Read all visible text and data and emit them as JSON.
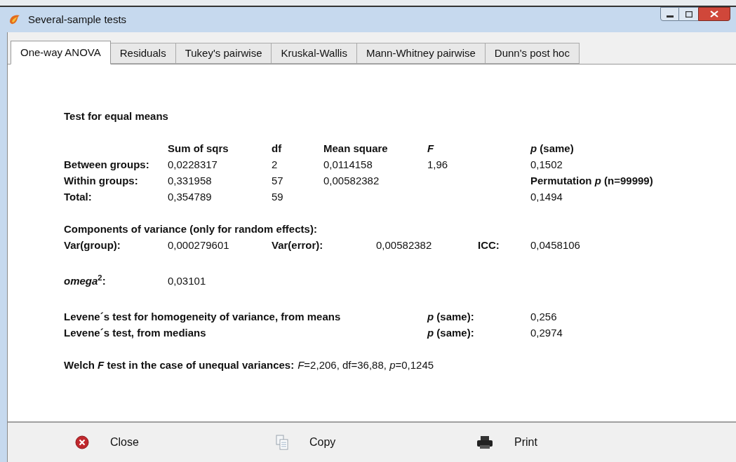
{
  "window": {
    "title": "Several-sample tests"
  },
  "tabs": [
    {
      "label": "One-way ANOVA",
      "selected": true
    },
    {
      "label": "Residuals",
      "selected": false
    },
    {
      "label": "Tukey's pairwise",
      "selected": false
    },
    {
      "label": "Kruskal-Wallis",
      "selected": false
    },
    {
      "label": "Mann-Whitney pairwise",
      "selected": false
    },
    {
      "label": "Dunn's post hoc",
      "selected": false
    }
  ],
  "anova": {
    "heading": "Test for equal means",
    "columns": [
      "Sum of sqrs",
      "df",
      "Mean square",
      "*F*",
      "*p* (same)"
    ],
    "rows": [
      {
        "label": "Between groups:",
        "cells": [
          {
            "text": "0,0228317",
            "kind": "value"
          },
          {
            "text": "2",
            "kind": "value"
          },
          {
            "text": "0,0114158",
            "kind": "value"
          },
          {
            "text": "1,96",
            "kind": "value"
          },
          {
            "text": "0,1502",
            "kind": "value"
          }
        ]
      },
      {
        "label": "Within groups:",
        "cells": [
          {
            "text": "0,331958",
            "kind": "value"
          },
          {
            "text": "57",
            "kind": "value"
          },
          {
            "text": "0,00582382",
            "kind": "value"
          },
          {
            "text": ""
          },
          {
            "text": "Permutation *p* (n=99999)",
            "kind": "heading"
          }
        ]
      },
      {
        "label": "Total:",
        "cells": [
          {
            "text": "0,354789",
            "kind": "value"
          },
          {
            "text": "59",
            "kind": "value"
          },
          {
            "text": ""
          },
          {
            "text": ""
          },
          {
            "text": "0,1494",
            "kind": "value"
          }
        ]
      }
    ]
  },
  "variance": {
    "heading": "Components of variance (only for random effects):",
    "items": [
      {
        "label": "Var(group):",
        "value": "0,000279601"
      },
      {
        "label": "Var(error):",
        "value": "0,00582382"
      },
      {
        "label": "ICC:",
        "value": "0,0458106"
      }
    ]
  },
  "omega": {
    "label": "*omega*$^{2}$:",
    "value": "0,03101"
  },
  "levene": [
    {
      "label": "Levene´s test for homogeneity of variance, from means",
      "p_label": "*p* (same):",
      "value": "0,256"
    },
    {
      "label": "Levene´s test, from medians",
      "p_label": "*p* (same):",
      "value": "0,2974"
    }
  ],
  "welch": {
    "label": "Welch *F* test in the case of unequal variances:",
    "result": "*F*=2,206, df=36,88, *p*=0,1245"
  },
  "buttons": [
    {
      "label": "Close",
      "kind": "close"
    },
    {
      "label": "Copy",
      "kind": "copy"
    },
    {
      "label": "Print",
      "kind": "print"
    }
  ]
}
